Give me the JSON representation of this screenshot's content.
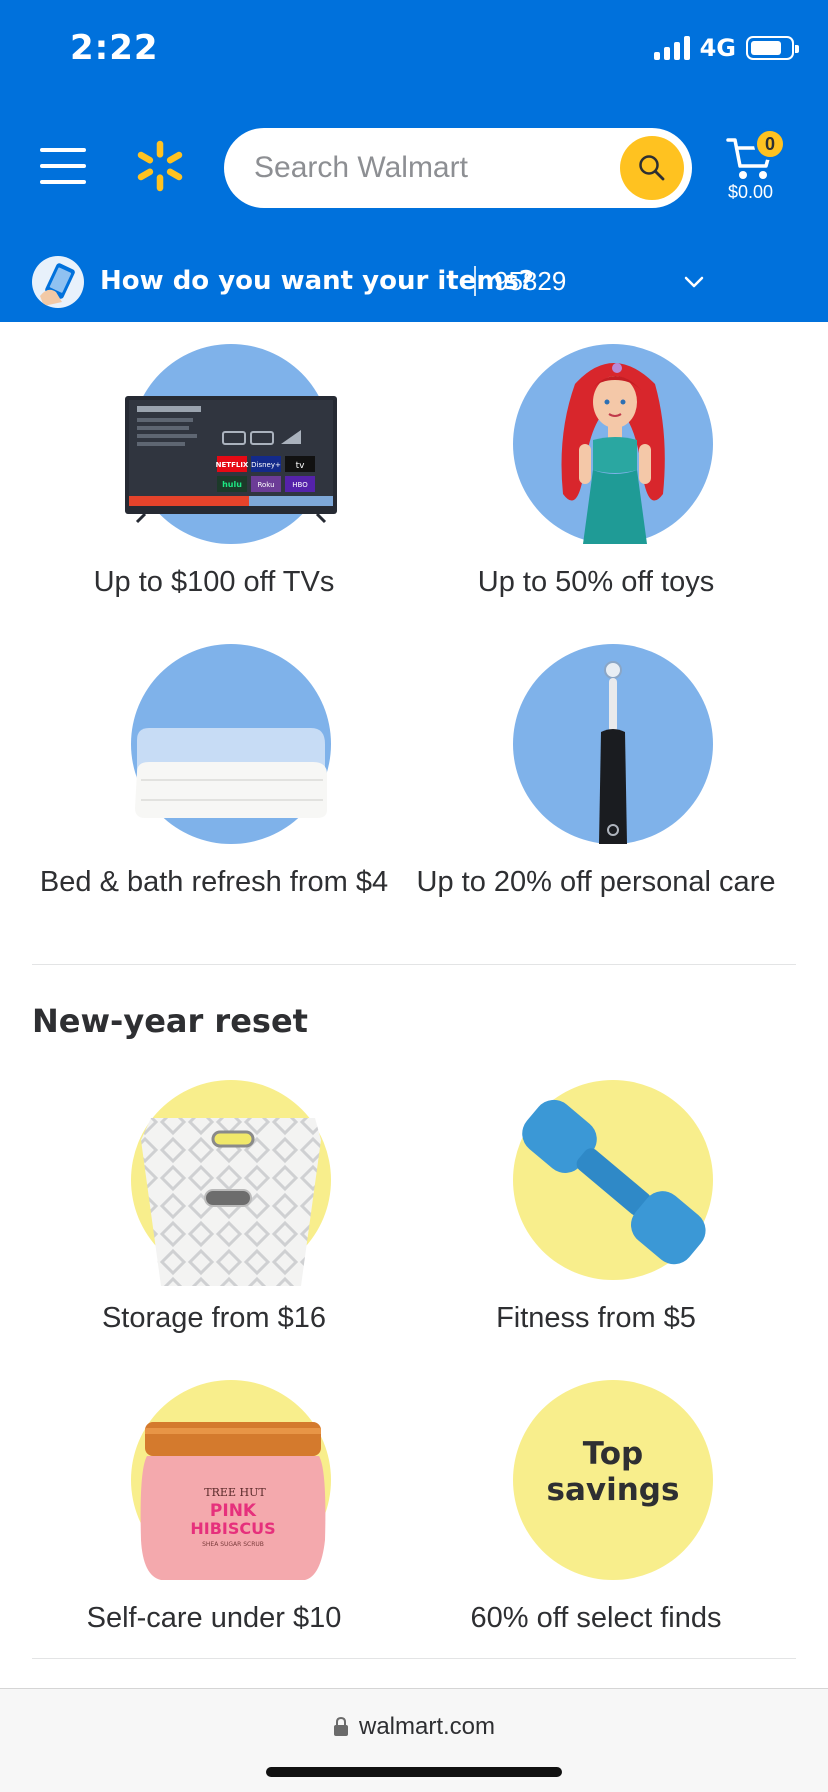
{
  "status_bar": {
    "time": "2:22",
    "network": "4G",
    "battery_level": 0.8
  },
  "header": {
    "search": {
      "placeholder": "Search Walmart"
    },
    "cart": {
      "count": "0",
      "total": "$0.00"
    },
    "delivery": {
      "question": "How do you want your items?",
      "zip": "95829"
    },
    "colors": {
      "brand_blue": "#0071dc",
      "spark_yellow": "#ffc220"
    }
  },
  "deals": [
    {
      "label": "Up to $100 off TVs",
      "icon": "tv-image"
    },
    {
      "label": "Up to 50% off toys",
      "icon": "doll-image"
    },
    {
      "label": "Bed & bath refresh from $4",
      "icon": "towels-image"
    },
    {
      "label": "Up to 20% off personal care",
      "icon": "toothbrush-image"
    }
  ],
  "reset_section": {
    "title": "New-year reset",
    "tiles": [
      {
        "label": "Storage from $16",
        "icon": "storage-bin-image"
      },
      {
        "label": "Fitness from $5",
        "icon": "dumbbell-image"
      },
      {
        "label": "Self-care under $10",
        "icon": "scrub-jar-image",
        "product_text": [
          "TREE HUT",
          "PINK",
          "HIBISCUS",
          "SHEA SUGAR SCRUB"
        ]
      },
      {
        "label": "60% off select finds",
        "icon": "top-savings-badge",
        "badge_text": "Top savings"
      }
    ]
  },
  "tv_screen_text": {
    "brand": "NETFLIX",
    "disney": "Disney+",
    "appletv": "tv",
    "hulu": "hulu",
    "roku": "Roku",
    "hbo": "HBO"
  },
  "browser": {
    "url": "walmart.com"
  }
}
